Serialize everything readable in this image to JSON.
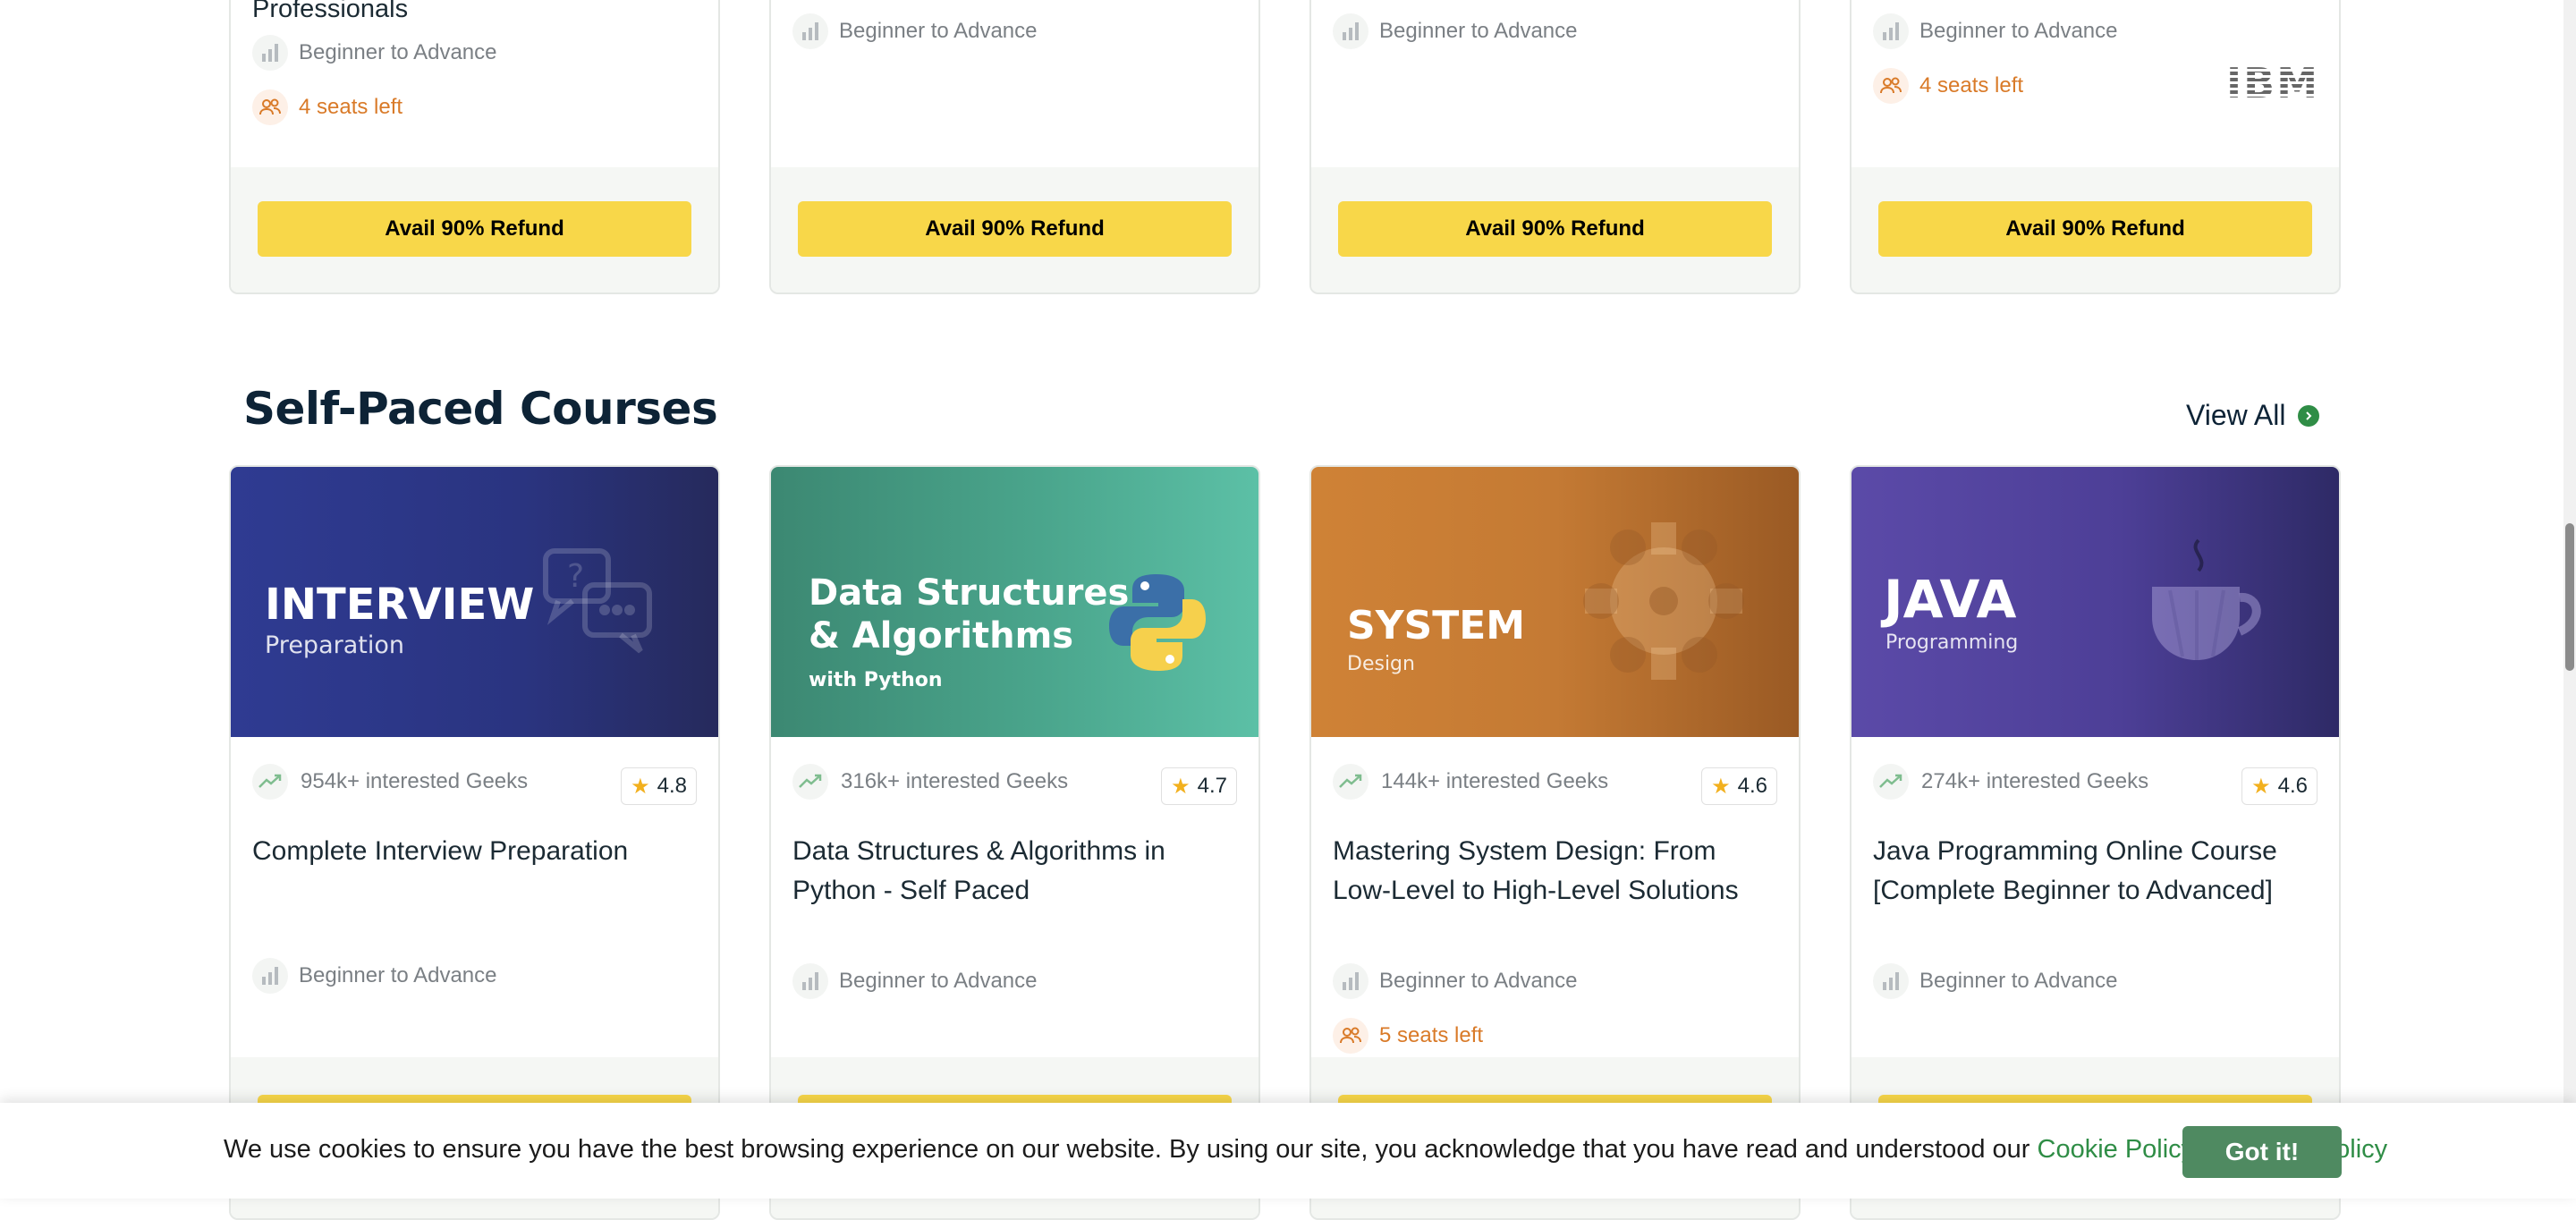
{
  "top_cards": [
    {
      "partial_title": "Professionals",
      "level": "Beginner to Advance",
      "seats": "4 seats left",
      "refund": "Avail 90% Refund"
    },
    {
      "level": "Beginner to Advance",
      "refund": "Avail 90% Refund"
    },
    {
      "level": "Beginner to Advance",
      "refund": "Avail 90% Refund"
    },
    {
      "level": "Beginner to Advance",
      "seats": "4 seats left",
      "logo": "IBM",
      "refund": "Avail 90% Refund"
    }
  ],
  "section": {
    "title": "Self-Paced Courses",
    "view_all": "View All"
  },
  "courses": [
    {
      "banner_title": "INTERVIEW",
      "banner_sub": "Preparation",
      "banner_icon": "chat-question-icon",
      "interested": "954k+ interested Geeks",
      "rating": "4.8",
      "title": "Complete Interview Preparation",
      "level": "Beginner to Advance"
    },
    {
      "banner_title_1": "Data Structures",
      "banner_title_2": "& Algorithms",
      "banner_sub": "with Python",
      "banner_icon": "python-logo-icon",
      "interested": "316k+ interested Geeks",
      "rating": "4.7",
      "title": "Data Structures & Algorithms in Python - Self Paced",
      "level": "Beginner to Advance"
    },
    {
      "banner_title": "SYSTEM",
      "banner_sub": "Design",
      "banner_icon": "gear-icon",
      "interested": "144k+ interested Geeks",
      "rating": "4.6",
      "title": "Mastering System Design: From Low-Level to High-Level Solutions",
      "level": "Beginner to Advance",
      "seats": "5 seats left"
    },
    {
      "banner_title": "JAVA",
      "banner_sub": "Programming",
      "banner_icon": "coffee-cup-icon",
      "interested": "274k+ interested Geeks",
      "rating": "4.6",
      "title": "Java Programming Online Course [Complete Beginner to Advanced]",
      "level": "Beginner to Advance"
    }
  ],
  "cookie": {
    "text": "We use cookies to ensure you have the best browsing experience on our website. By using our site, you acknowledge that you have read and understood our",
    "cookie_policy": "Cookie Policy",
    "amp": "&",
    "privacy_policy": "Privacy Policy",
    "button": "Got it!"
  },
  "colors": {
    "accent_green": "#2f8d46",
    "refund_yellow": "#f8d749",
    "seats_orange": "#d97a28"
  }
}
